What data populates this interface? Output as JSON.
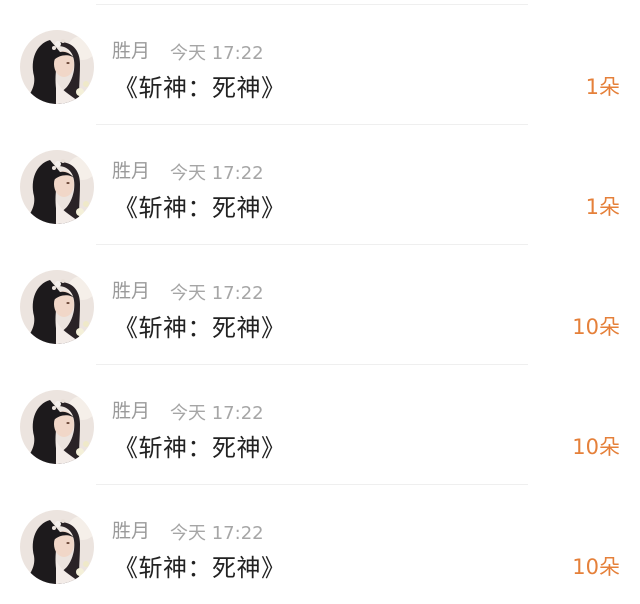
{
  "colors": {
    "accent": "#e5803a",
    "name": "#9a9a9a",
    "time": "#a6a6a6",
    "title": "#222222"
  },
  "gifts": [
    {
      "avatar_icon": "user-avatar-icon",
      "name": "胜月",
      "time": "今天 17:22",
      "title": "《斩神：死神》",
      "amount": "1朵"
    },
    {
      "avatar_icon": "user-avatar-icon",
      "name": "胜月",
      "time": "今天 17:22",
      "title": "《斩神：死神》",
      "amount": "1朵"
    },
    {
      "avatar_icon": "user-avatar-icon",
      "name": "胜月",
      "time": "今天 17:22",
      "title": "《斩神：死神》",
      "amount": "10朵"
    },
    {
      "avatar_icon": "user-avatar-icon",
      "name": "胜月",
      "time": "今天 17:22",
      "title": "《斩神：死神》",
      "amount": "10朵"
    },
    {
      "avatar_icon": "user-avatar-icon",
      "name": "胜月",
      "time": "今天 17:22",
      "title": "《斩神：死神》",
      "amount": "10朵"
    }
  ]
}
